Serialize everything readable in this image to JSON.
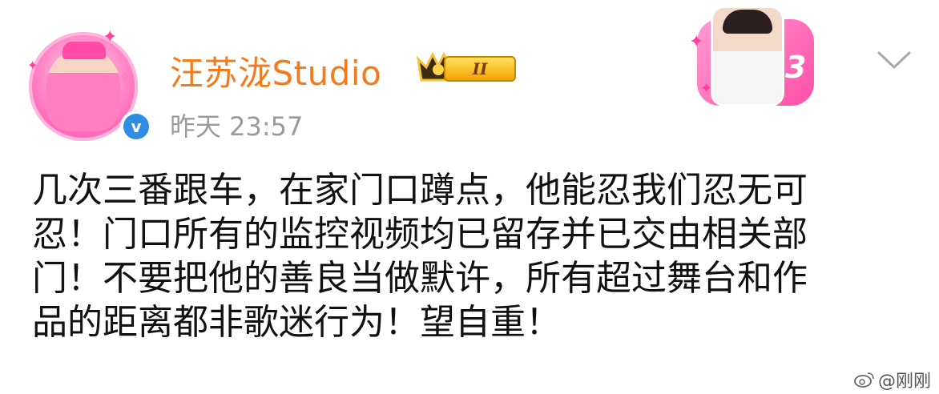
{
  "post": {
    "author_name": "汪苏泷Studio",
    "timestamp": "昨天 23:57",
    "member_level": "II",
    "verified": "v",
    "body_lines": [
      "几次三番跟车，在家门口蹲点，他能忍我们忍无可",
      "忍！门口所有的监控视频均已留存并已交由相关部",
      "门！不要把他的善良当做默许，所有超过舞台和作",
      "品的距离都非歌迷行为！望自重！"
    ],
    "decoration_number": "3"
  },
  "watermark": {
    "text": "@刚刚"
  },
  "icons": {
    "verified": "verified-v-icon",
    "badge": "crown-badge-icon",
    "more": "chevron-down-icon",
    "weibo": "weibo-logo-icon"
  },
  "colors": {
    "name": "#f47b1c",
    "timestamp": "#9a9a9a",
    "verified": "#2f8de4",
    "accent_pink": "#ff4fa8"
  }
}
